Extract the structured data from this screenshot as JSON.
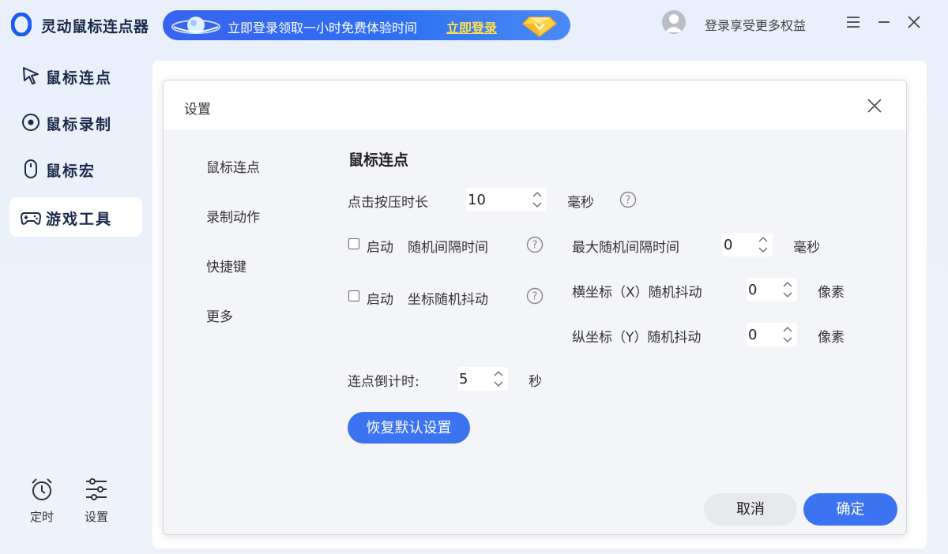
{
  "app": {
    "title": "灵动鼠标连点器",
    "promo_text": "立即登录领取一小时免费体验时间",
    "promo_link": "立即登录",
    "login_text": "登录享受更多权益"
  },
  "sidebar": {
    "items": [
      {
        "label": "鼠标连点",
        "icon": "cursor-click-icon",
        "active": false
      },
      {
        "label": "鼠标录制",
        "icon": "record-icon",
        "active": false
      },
      {
        "label": "鼠标宏",
        "icon": "mouse-icon",
        "active": false
      },
      {
        "label": "游戏工具",
        "icon": "gamepad-icon",
        "active": true
      }
    ],
    "bottom": [
      {
        "label": "定时",
        "icon": "alarm-clock-icon"
      },
      {
        "label": "设置",
        "icon": "sliders-icon"
      }
    ]
  },
  "dialog": {
    "title": "设置",
    "tabs": [
      "鼠标连点",
      "录制动作",
      "快捷键",
      "更多"
    ],
    "section_title": "鼠标连点",
    "press_duration": {
      "label": "点击按压时长",
      "value": "10",
      "unit": "毫秒"
    },
    "random_interval": {
      "enable_label": "启动",
      "label": "随机间隔时间",
      "checked": false,
      "max_label": "最大随机间隔时间",
      "max_value": "0",
      "unit": "毫秒"
    },
    "coord_jitter": {
      "enable_label": "启动",
      "label": "坐标随机抖动",
      "checked": false,
      "x_label": "横坐标（X）随机抖动",
      "x_value": "0",
      "y_label": "纵坐标（Y）随机抖动",
      "y_value": "0",
      "unit": "像素"
    },
    "countdown": {
      "label": "连点倒计时:",
      "value": "5",
      "unit": "秒"
    },
    "reset_label": "恢复默认设置",
    "cancel_label": "取消",
    "ok_label": "确定"
  },
  "colors": {
    "accent": "#3b73f0",
    "text_dark": "#1b2a4a",
    "promo_highlight": "#ffe14a"
  }
}
